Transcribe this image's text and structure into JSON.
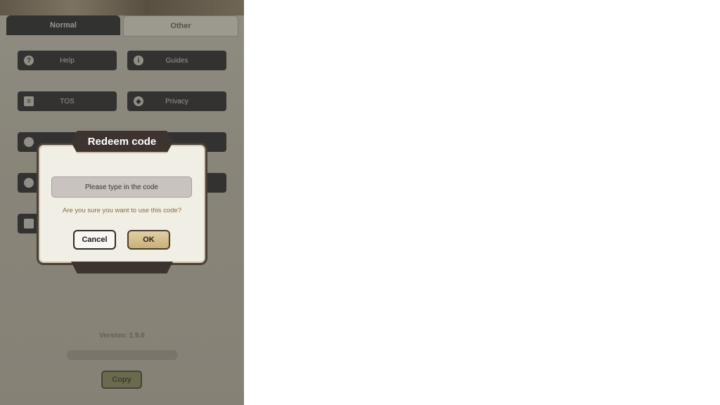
{
  "tabs": {
    "normal": "Normal",
    "other": "Other"
  },
  "menu": [
    {
      "label": "Help",
      "icon": "help-icon",
      "glyph": "?"
    },
    {
      "label": "Guides",
      "icon": "info-icon",
      "glyph": "i"
    },
    {
      "label": "TOS",
      "icon": "document-icon",
      "glyph": "≡"
    },
    {
      "label": "Privacy",
      "icon": "shield-icon",
      "glyph": "◆"
    }
  ],
  "version": "Version: 1.9.0",
  "copy_label": "Copy",
  "dialog": {
    "title": "Redeem code",
    "input_placeholder": "Please type in the code",
    "input_value": "",
    "confirm_text": "Are you sure you want to use this code?",
    "cancel_label": "Cancel",
    "ok_label": "OK"
  },
  "colors": {
    "overlay": "#2828266b",
    "dialog_bg": "#f1eee6",
    "title_plate": "#3d3430",
    "ok_gold": "#c9b07a",
    "confirm_text": "#8a6a3b"
  }
}
